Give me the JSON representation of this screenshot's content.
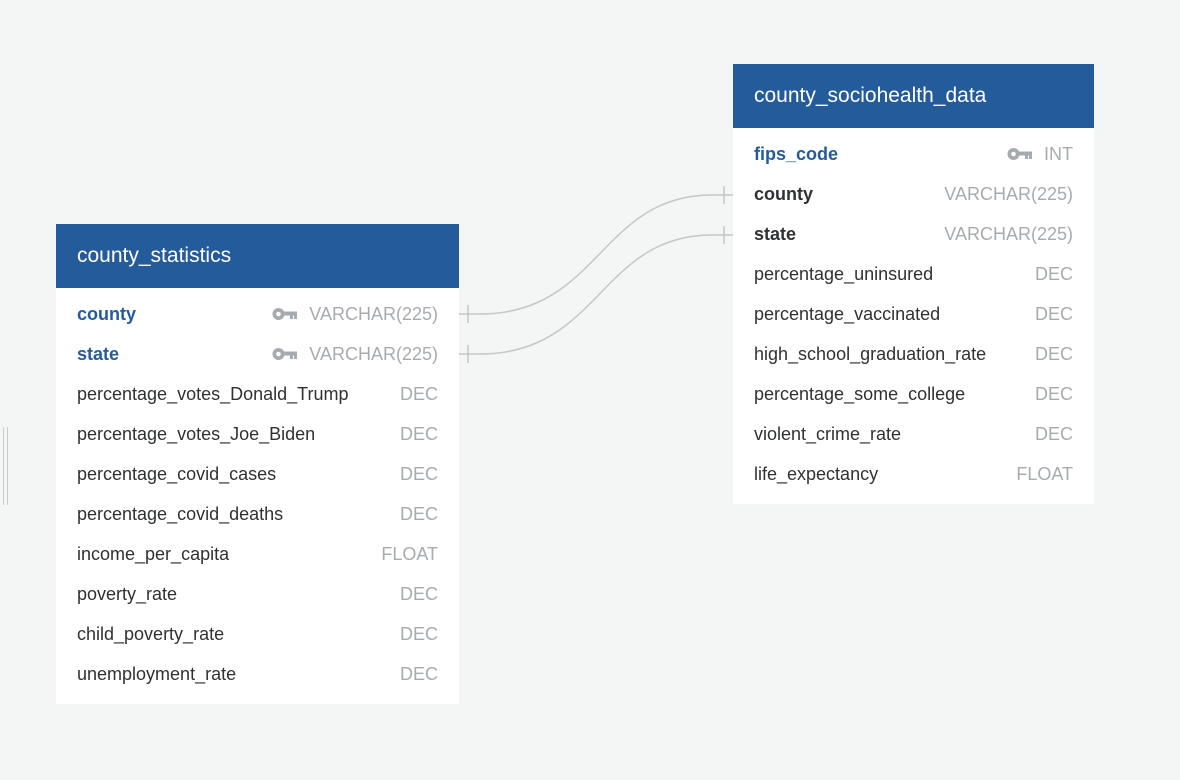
{
  "tables": {
    "county_statistics": {
      "name": "county_statistics",
      "columns": [
        {
          "name": "county",
          "type": "VARCHAR(225)",
          "key": "pk"
        },
        {
          "name": "state",
          "type": "VARCHAR(225)",
          "key": "pk"
        },
        {
          "name": "percentage_votes_Donald_Trump",
          "type": "DEC"
        },
        {
          "name": "percentage_votes_Joe_Biden",
          "type": "DEC"
        },
        {
          "name": "percentage_covid_cases",
          "type": "DEC"
        },
        {
          "name": "percentage_covid_deaths",
          "type": "DEC"
        },
        {
          "name": "income_per_capita",
          "type": "FLOAT"
        },
        {
          "name": "poverty_rate",
          "type": "DEC"
        },
        {
          "name": "child_poverty_rate",
          "type": "DEC"
        },
        {
          "name": "unemployment_rate",
          "type": "DEC"
        }
      ]
    },
    "county_sociohealth_data": {
      "name": "county_sociohealth_data",
      "columns": [
        {
          "name": "fips_code",
          "type": "INT",
          "key": "pk"
        },
        {
          "name": "county",
          "type": "VARCHAR(225)",
          "key": "fk"
        },
        {
          "name": "state",
          "type": "VARCHAR(225)",
          "key": "fk"
        },
        {
          "name": "percentage_uninsured",
          "type": "DEC"
        },
        {
          "name": "percentage_vaccinated",
          "type": "DEC"
        },
        {
          "name": "high_school_graduation_rate",
          "type": "DEC"
        },
        {
          "name": "percentage_some_college",
          "type": "DEC"
        },
        {
          "name": "violent_crime_rate",
          "type": "DEC"
        },
        {
          "name": "life_expectancy",
          "type": "FLOAT"
        }
      ]
    }
  },
  "relationships": [
    {
      "from": "county_statistics.county",
      "to": "county_sociohealth_data.county",
      "cardinality": "one-to-one"
    },
    {
      "from": "county_statistics.state",
      "to": "county_sociohealth_data.state",
      "cardinality": "one-to-one"
    }
  ],
  "colors": {
    "header": "#245b9a",
    "background": "#f4f6f5",
    "primary_key_text": "#245b9a",
    "type_text": "#a8abae",
    "connector": "#c4c7c9"
  },
  "icons": {
    "primary_key": "key-icon"
  }
}
